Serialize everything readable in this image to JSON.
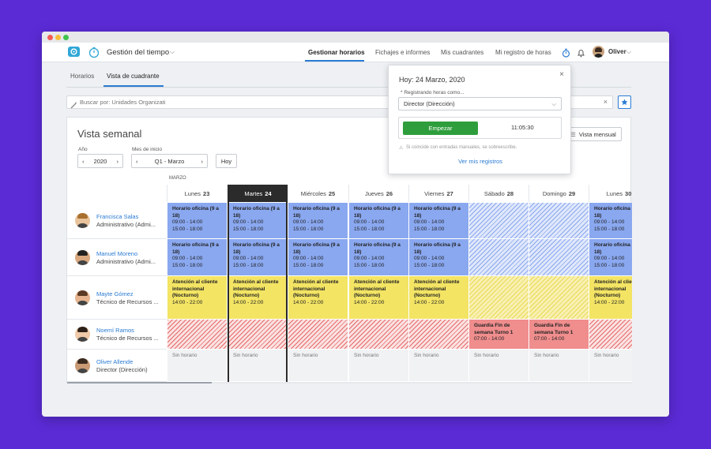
{
  "nav": {
    "app_title": "Gestión del tiempo",
    "links": [
      "Gestionar horarios",
      "Fichajes e informes",
      "Mis cuadrantes",
      "Mi registro de horas"
    ],
    "user": "Oliver"
  },
  "subtabs": [
    "Horarios",
    "Vista de cuadrante"
  ],
  "search": {
    "placeholder": "Buscar por: Unidades Organizati"
  },
  "view": {
    "title": "Vista semanal",
    "year_label": "Año",
    "year": "2020",
    "month_label": "Mes de inicio",
    "month": "Q1 - Marzo",
    "today_button": "Hoy",
    "monthly_view": "Vista mensual",
    "month_name": "MARZO"
  },
  "days": [
    {
      "name": "Lunes",
      "num": "23"
    },
    {
      "name": "Martes",
      "num": "24"
    },
    {
      "name": "Miércoles",
      "num": "25"
    },
    {
      "name": "Jueves",
      "num": "26"
    },
    {
      "name": "Viernes",
      "num": "27"
    },
    {
      "name": "Sábado",
      "num": "28"
    },
    {
      "name": "Domingo",
      "num": "29"
    },
    {
      "name": "Lunes",
      "num": "30"
    }
  ],
  "employees": [
    {
      "name": "Francisca Salas",
      "role": "Administrativo (Admi..."
    },
    {
      "name": "Manuel Moreno",
      "role": "Administrativo (Admi..."
    },
    {
      "name": "Mayte Gómez",
      "role": "Técnico de Recursos ..."
    },
    {
      "name": "Noemí Ramos",
      "role": "Técnico de Recursos ..."
    },
    {
      "name": "Oliver Allende",
      "role": "Director (Dirección)"
    }
  ],
  "shifts": {
    "office": {
      "title": "Horario oficina (9 a 18)",
      "t1": "09:00 - 14:00",
      "t2": "15:00 - 18:00"
    },
    "intl": {
      "title": "Atención al cliente internacional (Nocturno)",
      "t1": "14:00 - 22:00"
    },
    "weekend": {
      "title": "Guardia Fin de semana Turno 1",
      "t1": "07:00 - 14:00"
    },
    "none": "Sin horario"
  },
  "popup": {
    "title": "Hoy: 24 Marzo, 2020",
    "label": "* Registrando horas como...",
    "select_value": "Director (Dirección)",
    "start_button": "Empezar",
    "timer": "11:05:30",
    "note": "Si coincide con entradas manuales, se sobreescribe.",
    "link": "Ver mis registros"
  },
  "colors": {
    "brand": "#5b2bd6",
    "accent": "#2a7bd3",
    "start": "#2e9e3c",
    "office": "#8aa8f0",
    "intl": "#f3e464",
    "weekend": "#f08d8d"
  }
}
